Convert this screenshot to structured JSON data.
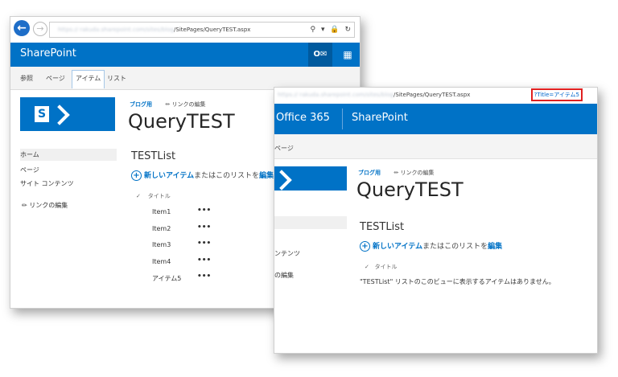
{
  "win1": {
    "url_prefix": "https://",
    "url_blurred": "rakuda.sharepoint.com/sites/blog",
    "url_suffix": "/SitePages/QueryTEST.aspx",
    "url_icons": "⚲ ▾ 🔒 ↻",
    "suite_title": "SharePoint",
    "ribbon_tabs": [
      "参照",
      "ページ",
      "アイテム",
      "リスト"
    ],
    "breadcrumb_blog": "ブログ用",
    "edit_links": "リンクの編集",
    "page_title": "QueryTEST",
    "nav": [
      "ホーム",
      "ページ",
      "サイト コンテンツ"
    ],
    "nav_edit": "リンクの編集",
    "list_title": "TESTList",
    "new_item": "新しいアイテム",
    "or_edit_text": "またはこのリストを",
    "edit": "編集",
    "col_title": "タイトル",
    "items": [
      "Item1",
      "Item2",
      "Item3",
      "Item4",
      "アイテム5"
    ],
    "dots": "•••"
  },
  "win2": {
    "url_prefix": "https://",
    "url_blurred": "rakuda.sharepoint.com/sites/blog",
    "url_suffix": "/SitePages/QueryTEST.aspx",
    "query": "?Title=アイテム5",
    "o365": "Office 365",
    "suite_title": "SharePoint",
    "page_tab": "ページ",
    "breadcrumb_blog": "ブログ用",
    "edit_links": "リンクの編集",
    "page_title": "QueryTEST",
    "list_title": "TESTList",
    "new_item": "新しいアイテム",
    "or_edit_text": "またはこのリストを",
    "edit": "編集",
    "nav_contents": "ンテンツ",
    "nav_edit": "の編集",
    "col_title": "タイトル",
    "empty_message": "\"TESTList\" リストのこのビューに表示するアイテムはありません。"
  },
  "colors": {
    "suite_blue": "#0072c6",
    "query_highlight": "#e02020"
  },
  "icons": [
    "back-arrow-icon",
    "forward-arrow-icon",
    "outlook-icon",
    "app-launcher-icon",
    "sharepoint-logo-icon",
    "pencil-icon",
    "add-circle-icon",
    "checkmark-icon"
  ]
}
